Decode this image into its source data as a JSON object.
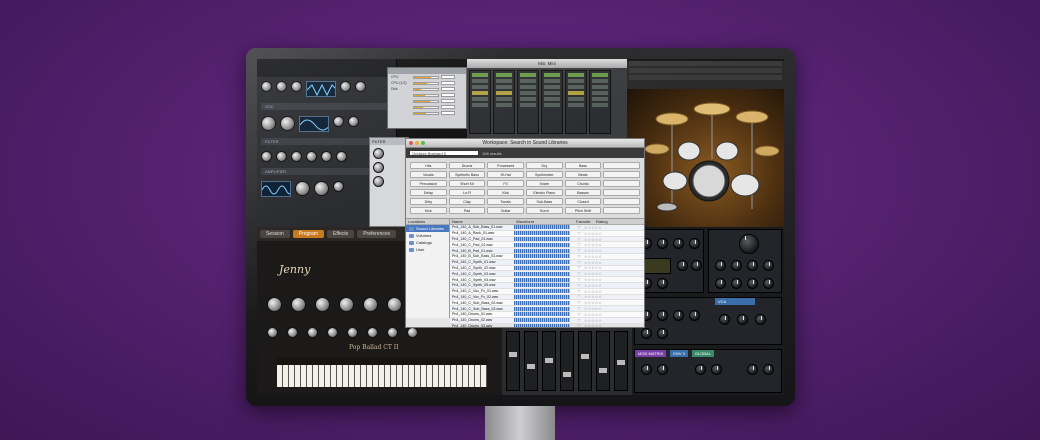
{
  "colors": {
    "background": "#51206c",
    "accent_orange": "#c77a20",
    "meter_fill": "#e0a030",
    "selection_blue": "#4a78c0",
    "waveform_blue": "#3f6fb8"
  },
  "mixer_title": "Mix: Mini",
  "synth": {
    "sections": [
      "OSC",
      "FILTER",
      "AMPLIFIER"
    ]
  },
  "meters": [
    {
      "label": "CPU",
      "fill": 0.72
    },
    {
      "label": "CPU (1/2)",
      "fill": 0.55
    },
    {
      "label": "Disk",
      "fill": 0.3
    },
    {
      "label": "",
      "fill": 0.45
    },
    {
      "label": "",
      "fill": 0.65
    },
    {
      "label": "",
      "fill": 0.38
    },
    {
      "label": "",
      "fill": 0.5
    }
  ],
  "piano": {
    "tabs": [
      "Session",
      "Program",
      "Effects",
      "Preferences"
    ],
    "active_tab": 1,
    "logo": "Jenny",
    "instrument_name": "Pop Ballad CT II"
  },
  "workspace": {
    "title": "Workspace: Search in Sound Libraries",
    "search_value": "Gridsize  Boshard  5",
    "result_count": "108 results",
    "categories": [
      "Hits",
      "Drums",
      "Processed",
      "Dry",
      "Bass",
      "",
      "Vocals",
      "Synthetic Bass",
      "Hi-Hat",
      "Synthesizer",
      "Beats",
      "",
      "Percussion",
      "Short Kit",
      "FX",
      "Snare",
      "Chords",
      "",
      "Delay",
      "Lo-Fi",
      "Kick",
      "Electric Piano",
      "Basses",
      "",
      "Dirty",
      "Clap",
      "Tonals",
      "Sub-Bass",
      "Closed",
      "",
      "Kick",
      "Pad",
      "Guitar",
      "Scrch",
      "Pitch Shift",
      ""
    ],
    "locations_header": "Locations",
    "locations": [
      {
        "label": "Sound Libraries",
        "selected": true
      },
      {
        "label": "Volumes",
        "selected": false
      },
      {
        "label": "Catalogs",
        "selected": false
      },
      {
        "label": "User",
        "selected": false
      }
    ],
    "columns": [
      "Name",
      "Waveform",
      "Favorite",
      "Rating"
    ],
    "files": [
      "Pn4_140_A_Sub_Bass_01.wav",
      "Pn4_140_A_Rack_01.wav",
      "Pn4_140_C_Pad_01.wav",
      "Pn4_140_C_Pad_01.wav",
      "Pn4_140_B_Pad_01.wav",
      "Pn4_140_B_Sub_Bass_03.wav",
      "Pn4_140_C_Synth_01.wav",
      "Pn4_140_C_Synth_02.wav",
      "Pn4_140_C_Synth_03.wav",
      "Pn4_140_C_Synth_04.wav",
      "Pn4_140_C_Synth_05.wav",
      "Pn4_140_C_Voc_Fx_01.wav",
      "Pn4_140_C_Voc_Fx_02.wav",
      "Pn4_140_C_Sub_Bass_02.wav",
      "Pn4_140_C_Sub_Bass_03.wav",
      "Pn4_140_Drums_01.wav",
      "Pn4_140_Drums_02.wav",
      "Pn4_140_Drums_03.wav"
    ],
    "rating_glyph": "☆☆☆☆☆",
    "favorite_glyph": "♡"
  },
  "rsynth": {
    "labels": [
      "VCA",
      "ENV 3",
      "MOD MATRIX",
      "GLOBAL"
    ]
  }
}
